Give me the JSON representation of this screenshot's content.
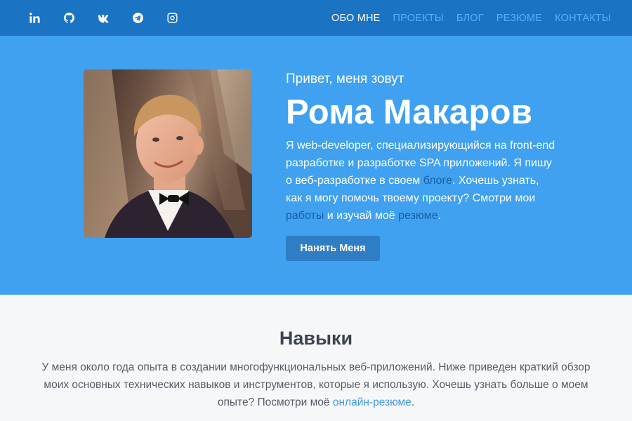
{
  "social": [
    {
      "name": "linkedin-icon"
    },
    {
      "name": "github-icon"
    },
    {
      "name": "vk-icon"
    },
    {
      "name": "telegram-icon"
    },
    {
      "name": "instagram-icon"
    }
  ],
  "nav": {
    "about": "ОБО МНЕ",
    "projects": "ПРОЕКТЫ",
    "blog": "БЛОГ",
    "resume": "РЕЗЮМЕ",
    "contacts": "КОНТАКТЫ"
  },
  "hero": {
    "greeting": "Привет, меня зовут",
    "name": "Рома Макаров",
    "bio_1": "Я web-developer, специализирующийся на front-end разработке и разработке SPA приложений. Я пишу о веб-разработке в своем ",
    "bio_blog_link": "блоге",
    "bio_2": ". Хочешь узнать, как я могу помочь твоему проекту? Смотри мои ",
    "bio_works_link": "работы",
    "bio_3": " и изучай моё ",
    "bio_resume_link": "резюме",
    "bio_4": ".",
    "hire_button": "Нанять Меня"
  },
  "skills": {
    "title": "Навыки",
    "text": "У меня около года опыта в создании многофункциональных веб-приложений. Ниже приведен краткий обзор моих основных технических навыков и инструментов, которые я использую. Хочешь узнать больше о моем опыте? Посмотри моё ",
    "link": "онлайн-резюме",
    "text_end": "."
  },
  "colors": {
    "topbar": "#1b73c4",
    "hero": "#3fa1f0",
    "nav_link": "#57b0ff",
    "button": "#2f7dc5"
  }
}
